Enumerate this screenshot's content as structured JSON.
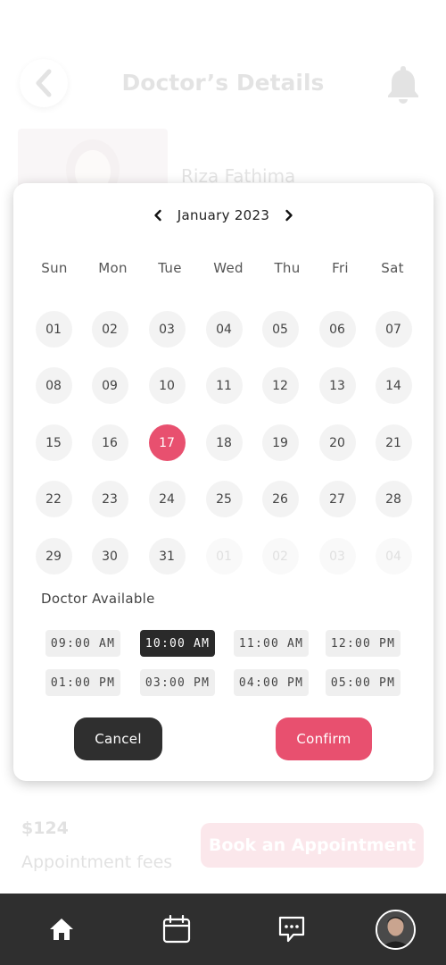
{
  "background": {
    "title": "Doctor’s Details",
    "doctor_name": "Riza Fathima",
    "fee_price": "$124",
    "fee_label": "Appointment fees",
    "book_button": "Book an Appointment"
  },
  "calendar": {
    "month_label": "January 2023",
    "weekdays": [
      "Sun",
      "Mon",
      "Tue",
      "Wed",
      "Thu",
      "Fri",
      "Sat"
    ],
    "days": [
      {
        "label": "01"
      },
      {
        "label": "02"
      },
      {
        "label": "03"
      },
      {
        "label": "04"
      },
      {
        "label": "05"
      },
      {
        "label": "06"
      },
      {
        "label": "07"
      },
      {
        "label": "08"
      },
      {
        "label": "09"
      },
      {
        "label": "10"
      },
      {
        "label": "11"
      },
      {
        "label": "12"
      },
      {
        "label": "13"
      },
      {
        "label": "14"
      },
      {
        "label": "15"
      },
      {
        "label": "16"
      },
      {
        "label": "17",
        "selected": true
      },
      {
        "label": "18"
      },
      {
        "label": "19"
      },
      {
        "label": "20"
      },
      {
        "label": "21"
      },
      {
        "label": "22"
      },
      {
        "label": "23"
      },
      {
        "label": "24"
      },
      {
        "label": "25"
      },
      {
        "label": "26"
      },
      {
        "label": "27"
      },
      {
        "label": "28"
      },
      {
        "label": "29"
      },
      {
        "label": "30"
      },
      {
        "label": "31"
      },
      {
        "label": "01",
        "muted": true
      },
      {
        "label": "02",
        "muted": true
      },
      {
        "label": "03",
        "muted": true
      },
      {
        "label": "04",
        "muted": true
      }
    ]
  },
  "availability": {
    "label": "Doctor Available",
    "slots": [
      {
        "time": "09:00 AM"
      },
      {
        "time": "10:00 AM",
        "selected": true
      },
      {
        "time": "11:00 AM"
      },
      {
        "time": "12:00 PM"
      },
      {
        "time": "01:00 PM"
      },
      {
        "time": "03:00 PM"
      },
      {
        "time": "04:00 PM"
      },
      {
        "time": "05:00 PM"
      }
    ]
  },
  "actions": {
    "cancel": "Cancel",
    "confirm": "Confirm"
  },
  "colors": {
    "accent": "#e8506f",
    "dark": "#2f2f2f"
  },
  "bottom_nav": {
    "items": [
      "home-icon",
      "calendar-icon",
      "chat-icon",
      "avatar"
    ]
  }
}
